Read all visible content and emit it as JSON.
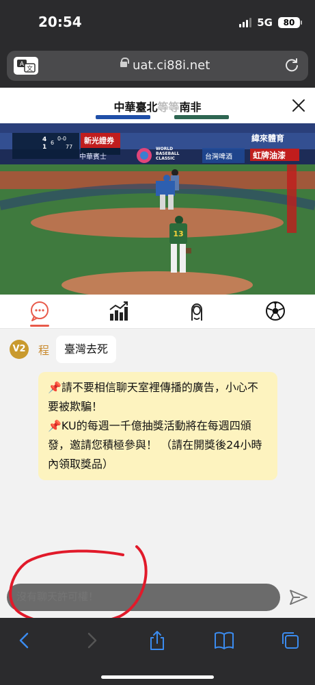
{
  "status_bar": {
    "time": "20:54",
    "network": "5G",
    "battery": "80"
  },
  "browser": {
    "url": "uat.ci88i.net"
  },
  "match": {
    "home_team": "中華臺北",
    "vs": "等等",
    "away_team": "南非",
    "home_color": "#1f4fa8",
    "away_color": "#2e6652"
  },
  "video": {
    "broadcaster": "緯來體育",
    "score_home": "4",
    "score_away": "1",
    "inning": "6",
    "count": "0-0",
    "pitch_speed": "77",
    "sponsor_1": "新光證券",
    "sponsor_2": "中華賓士",
    "sponsor_3": "台灣啤酒",
    "sponsor_4": "虹牌油漆",
    "tournament": "WORLD BASEBALL CLASSIC",
    "player_number": "13"
  },
  "tabs": [
    {
      "icon": "chat-icon",
      "active": true
    },
    {
      "icon": "stats-icon",
      "active": false
    },
    {
      "icon": "anchor-icon",
      "active": false
    },
    {
      "icon": "soccer-ball-icon",
      "active": false
    }
  ],
  "chat": {
    "messages": [
      {
        "badge": "V2",
        "username": "程",
        "text": "臺灣去死"
      }
    ],
    "notice": {
      "line1_pin": "📌",
      "line1": "請不要相信聊天室裡傳播的廣告，小心不要被欺騙！",
      "line2_pin": "📌",
      "line2": "KU的每週一千億抽獎活動將在每週四頒發，邀請您積極參與！ （請在開獎後24小時內領取獎品）"
    }
  },
  "input": {
    "placeholder": "沒有聊天許可權！"
  },
  "accent_color": "#e85a4a"
}
